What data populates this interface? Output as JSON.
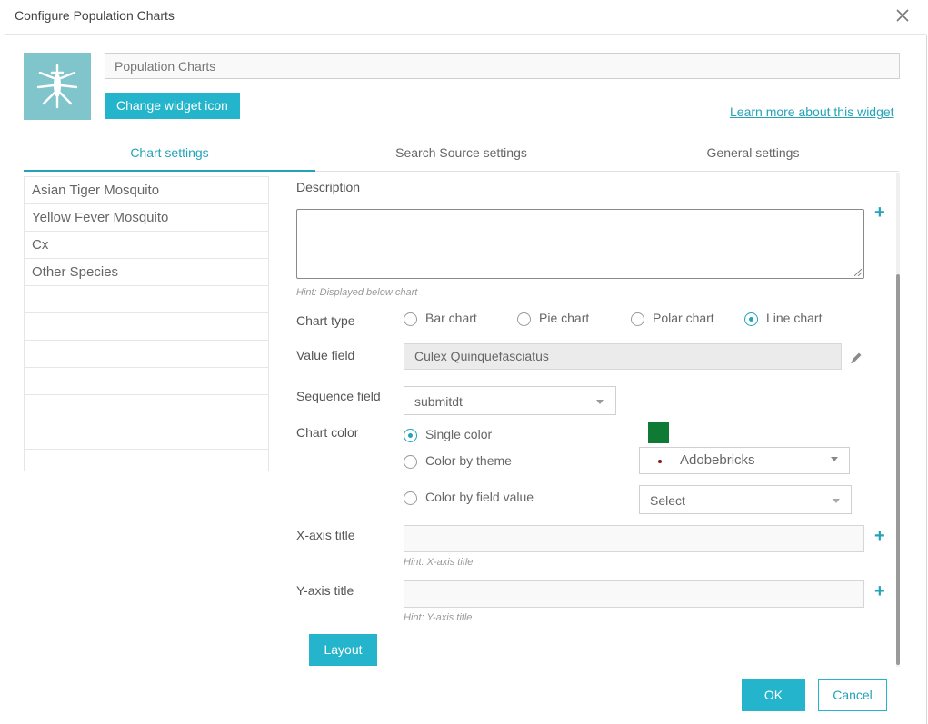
{
  "dialog": {
    "title": "Configure Population Charts",
    "close_icon": "close-icon"
  },
  "widget": {
    "icon": "mosquito-icon",
    "name_value": "Population Charts",
    "change_icon_label": "Change widget icon",
    "learn_more_label": "Learn more about this widget"
  },
  "tabs": [
    {
      "label": "Chart settings",
      "active": true
    },
    {
      "label": "Search Source settings",
      "active": false
    },
    {
      "label": "General settings",
      "active": false
    }
  ],
  "chart_list": {
    "items": [
      "Asian Tiger Mosquito",
      "Yellow Fever Mosquito",
      "Cx",
      "Other Species",
      "",
      "",
      "",
      "",
      "",
      "",
      ""
    ]
  },
  "form": {
    "description_label": "Description",
    "description_value": "",
    "description_hint": "Hint: Displayed below chart",
    "chart_type_label": "Chart type",
    "chart_types": [
      {
        "label": "Bar chart",
        "selected": false
      },
      {
        "label": "Pie chart",
        "selected": false
      },
      {
        "label": "Polar chart",
        "selected": false
      },
      {
        "label": "Line chart",
        "selected": true
      }
    ],
    "value_field_label": "Value field",
    "value_field_value": "Culex Quinquefasciatus",
    "sequence_field_label": "Sequence field",
    "sequence_field_value": "submitdt",
    "chart_color_label": "Chart color",
    "color_options": [
      {
        "label": "Single color",
        "selected": true
      },
      {
        "label": "Color by theme",
        "selected": false
      },
      {
        "label": "Color by field value",
        "selected": false
      }
    ],
    "single_color": "#0f7a34",
    "theme_value": "Adobebricks",
    "field_value_select": "Select",
    "x_axis_label": "X-axis title",
    "x_axis_value": "",
    "x_axis_hint": "Hint: X-axis title",
    "y_axis_label": "Y-axis title",
    "y_axis_value": "",
    "y_axis_hint": "Hint: Y-axis title",
    "layout_label": "Layout"
  },
  "footer": {
    "ok_label": "OK",
    "cancel_label": "Cancel"
  },
  "colors": {
    "accent": "#24b5cc",
    "icon_bg": "#81c5cc"
  }
}
